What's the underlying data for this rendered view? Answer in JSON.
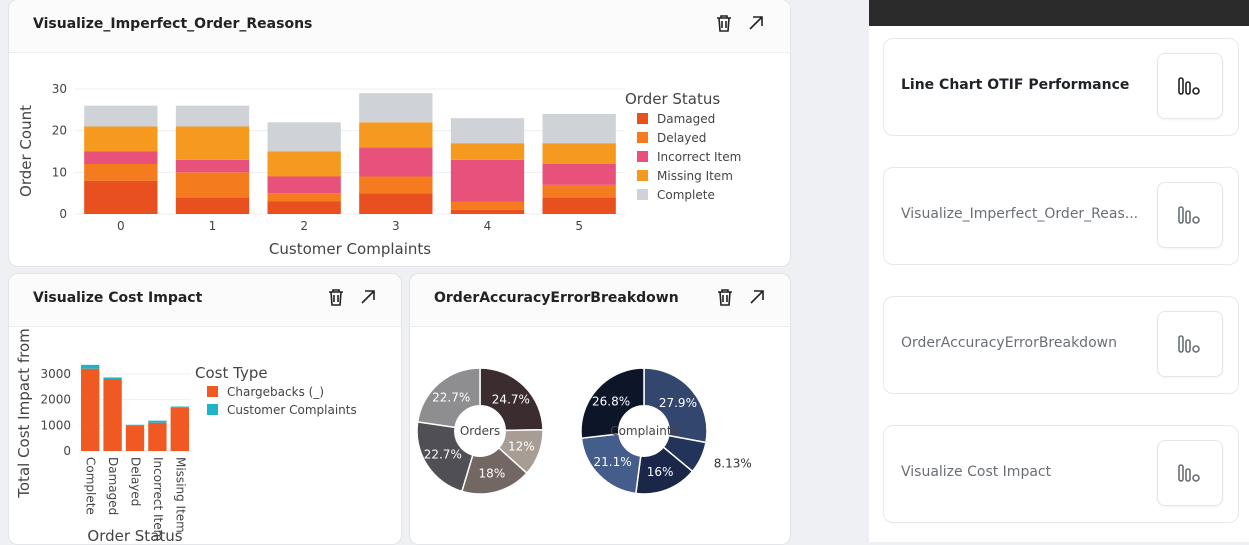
{
  "cards": {
    "reasons": {
      "title": "Visualize_Imperfect_Order_Reasons"
    },
    "cost": {
      "title": "Visualize Cost Impact"
    },
    "accuracy": {
      "title": "OrderAccuracyErrorBreakdown"
    }
  },
  "icons": {
    "delete": "trash-icon",
    "expand": "expand-arrow-icon",
    "chart": "bar-chart-icon"
  },
  "sidebar": {
    "items": [
      {
        "label": "Line Chart OTIF Performance",
        "active": true
      },
      {
        "label": "Visualize_Imperfect_Order_Reas...",
        "active": false
      },
      {
        "label": "OrderAccuracyErrorBreakdown",
        "active": false
      },
      {
        "label": "Visualize Cost Impact",
        "active": false
      }
    ]
  },
  "chart_data": [
    {
      "type": "bar",
      "stacked": true,
      "xlabel": "Customer Complaints",
      "ylabel": "Order Count",
      "categories": [
        "0",
        "1",
        "2",
        "3",
        "4",
        "5"
      ],
      "ylim": [
        0,
        30
      ],
      "yticks": [
        0,
        10,
        20,
        30
      ],
      "legend_title": "Order Status",
      "legend_position": "right",
      "series": [
        {
          "name": "Damaged",
          "color": "#e8511f",
          "values": [
            8,
            4,
            3,
            5,
            1,
            4
          ]
        },
        {
          "name": "Delayed",
          "color": "#f47c1f",
          "values": [
            4,
            6,
            2,
            4,
            2,
            3
          ]
        },
        {
          "name": "Incorrect Item",
          "color": "#e8517a",
          "values": [
            3,
            3,
            4,
            7,
            10,
            5
          ]
        },
        {
          "name": "Missing Item",
          "color": "#f59a1f",
          "values": [
            6,
            8,
            6,
            6,
            4,
            5
          ]
        },
        {
          "name": "Complete",
          "color": "#cfd3d7",
          "values": [
            5,
            5,
            7,
            7,
            6,
            7
          ]
        }
      ]
    },
    {
      "type": "bar",
      "stacked": true,
      "xlabel": "Order Status",
      "ylabel": "Total Cost Impact from",
      "categories": [
        "Complete",
        "Damaged",
        "Delayed",
        "Incorrect Item",
        "Missing Item"
      ],
      "ylim": [
        0,
        3500
      ],
      "yticks": [
        0,
        1000,
        2000,
        3000
      ],
      "legend_title": "Cost Type",
      "legend_position": "right",
      "series": [
        {
          "name": "Chargebacks (_)",
          "color": "#f05a22",
          "values": [
            3200,
            2800,
            1000,
            1100,
            1700
          ]
        },
        {
          "name": "Customer Complaints",
          "color": "#1fb3c7",
          "values": [
            150,
            60,
            20,
            80,
            30
          ]
        }
      ]
    },
    {
      "type": "pie",
      "hole": 0.4,
      "center_label": "Orders",
      "slices": [
        {
          "value": 24.7,
          "label": "24.7%",
          "color": "#3b2d2f"
        },
        {
          "value": 12,
          "label": "12%",
          "color": "#a89d94"
        },
        {
          "value": 18,
          "label": "18%",
          "color": "#736763"
        },
        {
          "value": 22.7,
          "label": "22.7%",
          "color": "#4f4f55"
        },
        {
          "value": 22.7,
          "label": "22.7%",
          "color": "#8e8e90"
        }
      ]
    },
    {
      "type": "pie",
      "hole": 0.4,
      "center_label": "Complaints",
      "slices": [
        {
          "value": 27.9,
          "label": "27.9%",
          "color": "#33466d"
        },
        {
          "value": 8.13,
          "label": "8.13%",
          "color": "#22345a"
        },
        {
          "value": 16,
          "label": "16%",
          "color": "#1a2749"
        },
        {
          "value": 21.1,
          "label": "21.1%",
          "color": "#455d8a"
        },
        {
          "value": 26.8,
          "label": "26.8%",
          "color": "#0d1628"
        }
      ]
    }
  ]
}
